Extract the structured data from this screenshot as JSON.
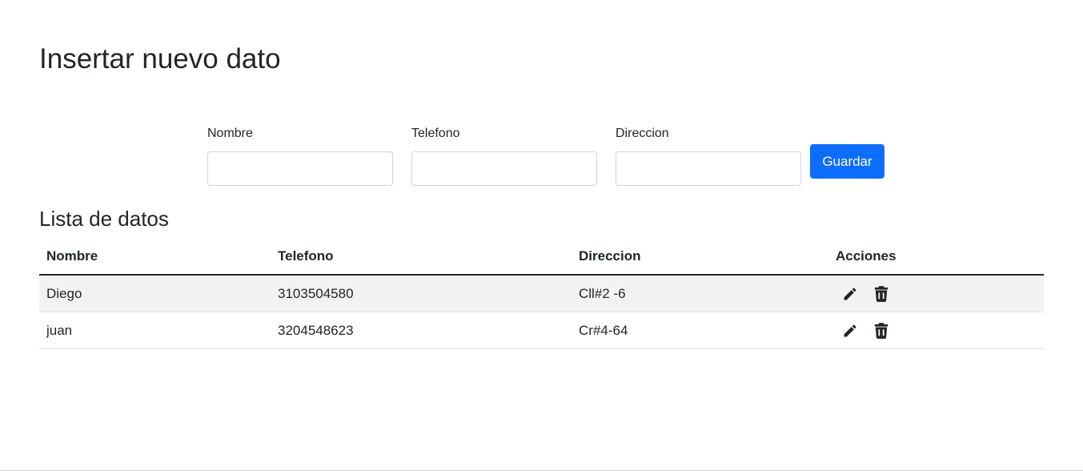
{
  "page": {
    "title": "Insertar nuevo dato"
  },
  "form": {
    "nombre_label": "Nombre",
    "nombre_value": "",
    "telefono_label": "Telefono",
    "telefono_value": "",
    "direccion_label": "Direccion",
    "direccion_value": "",
    "save_label": "Guardar"
  },
  "list": {
    "title": "Lista de datos",
    "headers": {
      "nombre": "Nombre",
      "telefono": "Telefono",
      "direccion": "Direccion",
      "acciones": "Acciones"
    },
    "rows": [
      {
        "nombre": "Diego",
        "telefono": "3103504580",
        "direccion": "Cll#2 -6"
      },
      {
        "nombre": "juan",
        "telefono": "3204548623",
        "direccion": "Cr#4-64"
      }
    ]
  },
  "icons": {
    "edit": "pencil-icon",
    "delete": "trash-icon"
  },
  "colors": {
    "primary_button": "#0d6efd",
    "text": "#212529",
    "striped_row": "#f2f2f2"
  }
}
